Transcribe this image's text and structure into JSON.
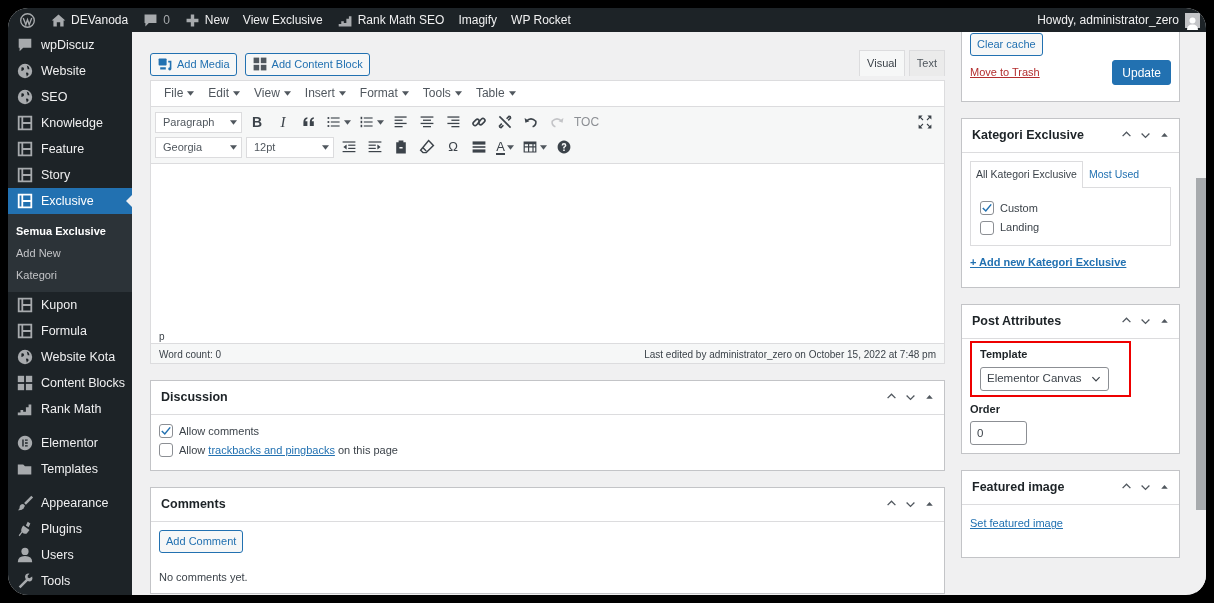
{
  "admin_bar": {
    "items": [
      {
        "kind": "logo"
      },
      {
        "kind": "home",
        "label": "DEVanoda"
      },
      {
        "kind": "comments",
        "label": "0"
      },
      {
        "kind": "new",
        "label": "New"
      },
      {
        "kind": "plain",
        "label": "View Exclusive"
      },
      {
        "kind": "rankmath",
        "label": "Rank Math SEO"
      },
      {
        "kind": "plain",
        "label": "Imagify"
      },
      {
        "kind": "plain",
        "label": "WP Rocket"
      }
    ],
    "greeting": "Howdy, administrator_zero"
  },
  "sidebar": {
    "groups": [
      [
        {
          "kind": "comment",
          "label": "wpDiscuz",
          "selected": false
        },
        {
          "kind": "globe",
          "label": "Website",
          "selected": false
        },
        {
          "kind": "globe",
          "label": "SEO",
          "selected": false
        },
        {
          "kind": "layout",
          "label": "Knowledge",
          "selected": false
        },
        {
          "kind": "layout",
          "label": "Feature",
          "selected": false
        },
        {
          "kind": "layout",
          "label": "Story",
          "selected": false
        },
        {
          "kind": "layout",
          "label": "Exclusive",
          "selected": true,
          "children": [
            {
              "label": "Semua Exclusive",
              "selected": true
            },
            {
              "label": "Add New",
              "selected": false
            },
            {
              "label": "Kategori",
              "selected": false
            }
          ]
        },
        {
          "kind": "layout",
          "label": "Kupon",
          "selected": false
        },
        {
          "kind": "layout",
          "label": "Formula",
          "selected": false
        },
        {
          "kind": "globe",
          "label": "Website Kota",
          "selected": false
        },
        {
          "kind": "grid",
          "label": "Content Blocks",
          "selected": false
        },
        {
          "kind": "chart",
          "label": "Rank Math",
          "selected": false
        }
      ],
      [
        {
          "kind": "elementor",
          "label": "Elementor",
          "selected": false
        },
        {
          "kind": "folder",
          "label": "Templates",
          "selected": false
        }
      ],
      [
        {
          "kind": "brush",
          "label": "Appearance",
          "selected": false
        },
        {
          "kind": "plug",
          "label": "Plugins",
          "selected": false
        },
        {
          "kind": "user",
          "label": "Users",
          "selected": false
        },
        {
          "kind": "wrench",
          "label": "Tools",
          "selected": false
        }
      ]
    ]
  },
  "editor": {
    "media_buttons": [
      {
        "kind": "media",
        "label": "Add Media"
      },
      {
        "kind": "blocks",
        "label": "Add Content Block"
      }
    ],
    "tabs": [
      {
        "label": "Visual",
        "selected": true
      },
      {
        "label": "Text",
        "selected": false
      }
    ],
    "menus": [
      "File",
      "Edit",
      "View",
      "Insert",
      "Format",
      "Tools",
      "Table"
    ],
    "toolbar_rows": [
      [
        {
          "kind": "select",
          "label": "Paragraph",
          "disabled": false
        },
        {
          "kind": "bold",
          "label": "B",
          "disabled": false
        },
        {
          "kind": "italic",
          "label": "I",
          "disabled": false
        },
        {
          "kind": "quote",
          "disabled": false
        },
        {
          "kind": "bullist",
          "disabled": false
        },
        {
          "kind": "numlist",
          "disabled": false
        },
        {
          "kind": "alignleft",
          "disabled": false
        },
        {
          "kind": "aligncenter",
          "disabled": false
        },
        {
          "kind": "alignright",
          "disabled": false
        },
        {
          "kind": "link",
          "disabled": false
        },
        {
          "kind": "unlink",
          "disabled": false
        },
        {
          "kind": "undo",
          "disabled": false
        },
        {
          "kind": "redo",
          "disabled": true
        },
        {
          "kind": "text",
          "label": "TOC",
          "disabled": false
        }
      ],
      [
        {
          "kind": "select",
          "label": "Georgia",
          "disabled": false
        },
        {
          "kind": "select",
          "label": "12pt",
          "disabled": false
        },
        {
          "kind": "outdent",
          "disabled": false
        },
        {
          "kind": "indent",
          "disabled": false
        },
        {
          "kind": "paste",
          "disabled": false
        },
        {
          "kind": "eraser",
          "disabled": false
        },
        {
          "kind": "char",
          "label": "Ω",
          "disabled": false
        },
        {
          "kind": "hr",
          "disabled": false
        },
        {
          "kind": "color",
          "label": "A",
          "disabled": false
        },
        {
          "kind": "table",
          "disabled": false
        },
        {
          "kind": "help",
          "disabled": false
        }
      ]
    ],
    "path": "p",
    "word_count": "Word count: 0",
    "last_edited": "Last edited by administrator_zero on October 15, 2022 at 7:48 pm"
  },
  "discussion": {
    "title": "Discussion",
    "options": [
      {
        "checked": true,
        "text": "Allow comments"
      },
      {
        "checked": false,
        "text": "Allow ",
        "link": "trackbacks and pingbacks",
        "text_after": " on this page"
      }
    ]
  },
  "comments": {
    "title": "Comments",
    "button": "Add Comment",
    "empty": "No comments yet."
  },
  "publish": {
    "clear_cache": "Clear cache",
    "trash": "Move to Trash",
    "update": "Update"
  },
  "kategori": {
    "title": "Kategori Exclusive",
    "tabs": [
      {
        "label": "All Kategori Exclusive",
        "selected": true
      },
      {
        "label": "Most Used",
        "selected": false
      }
    ],
    "items": [
      {
        "label": "Custom",
        "checked": true
      },
      {
        "label": "Landing",
        "checked": false
      }
    ],
    "add_link": "+ Add new Kategori Exclusive"
  },
  "post_attributes": {
    "title": "Post Attributes",
    "template": {
      "label": "Template",
      "value": "Elementor Canvas",
      "highlighted": true
    },
    "order": {
      "label": "Order",
      "value": "0"
    }
  },
  "featured": {
    "title": "Featured image",
    "link": "Set featured image"
  }
}
